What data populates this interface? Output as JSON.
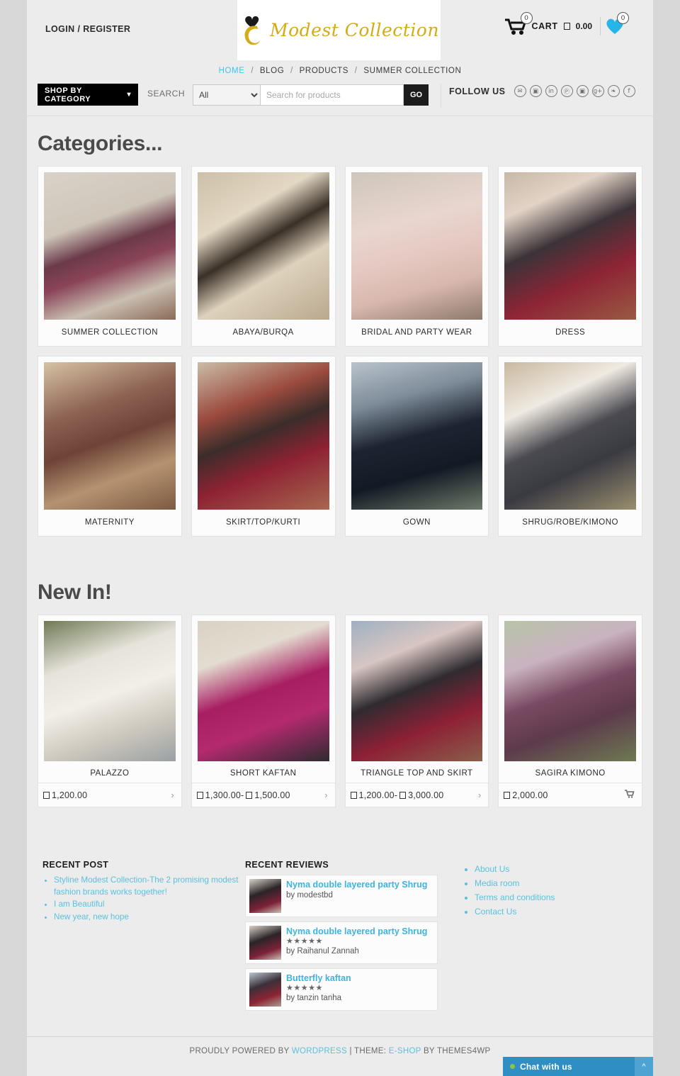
{
  "header": {
    "login_label": "LOGIN / REGISTER",
    "logo_text": "Modest Collection",
    "cart_label": "CART",
    "cart_amount": "0.00",
    "cart_count": "0",
    "wishlist_count": "0",
    "currency_glyph": "box-glyph"
  },
  "breadcrumb": {
    "items": [
      {
        "label": "HOME",
        "active": true
      },
      {
        "label": "BLOG",
        "active": false
      },
      {
        "label": "PRODUCTS",
        "active": false
      },
      {
        "label": "SUMMER COLLECTION",
        "active": false
      }
    ],
    "separator": "/"
  },
  "searchbar": {
    "shop_by_category": "SHOP BY CATEGORY",
    "search_label": "SEARCH",
    "category_selected": "All",
    "category_options": [
      "All"
    ],
    "placeholder": "Search for products",
    "search_value": "",
    "go_label": "GO",
    "follow_label": "FOLLOW US",
    "social": [
      {
        "name": "email-icon",
        "glyph": "✉"
      },
      {
        "name": "flickr-icon",
        "glyph": "▣"
      },
      {
        "name": "linkedin-icon",
        "glyph": "in"
      },
      {
        "name": "pinterest-icon",
        "glyph": "Ⓟ"
      },
      {
        "name": "instagram-icon",
        "glyph": "▣"
      },
      {
        "name": "googleplus-icon",
        "glyph": "g+"
      },
      {
        "name": "twitter-icon",
        "glyph": "❧"
      },
      {
        "name": "facebook-icon",
        "glyph": "f"
      }
    ]
  },
  "categories_section": {
    "title": "Categories...",
    "items": [
      {
        "label": "SUMMER COLLECTION",
        "img": "linear-gradient(160deg,#d9d2c8 0%,#cfc6ba 34%,#6b3a4a 50%,#8a4458 62%,#c9bfb2 80%,#8a6a58 100%)"
      },
      {
        "label": "ABAYA/BURQA",
        "img": "linear-gradient(150deg,#cdbfa8 0%,#e3d8c4 30%,#3a3028 48%,#ded2bd 66%,#b9a88e 100%)"
      },
      {
        "label": "BRIDAL AND PARTY WEAR",
        "img": "linear-gradient(165deg,#cfc6bb 0%,#e8d6cf 35%,#e5c9c2 55%,#d8b8ae 75%,#8d7a6c 100%)"
      },
      {
        "label": "DRESS",
        "img": "linear-gradient(155deg,#c7b9a6 0%,#e2d3c6 22%,#3b3338 45%,#8d2436 70%,#9a5a43 100%)"
      },
      {
        "label": "MATERNITY",
        "img": "linear-gradient(160deg,#d6c3a4 0%,#8d6253 32%,#6e4338 52%,#b59371 74%,#7b5a42 100%)"
      },
      {
        "label": "SKIRT/TOP/KURTI",
        "img": "linear-gradient(158deg,#cbbda8 0%,#9b4a3e 30%,#3b2d2a 48%,#8e2234 68%,#a6684f 100%)"
      },
      {
        "label": "GOWN",
        "img": "linear-gradient(165deg,#b9c3cc 0%,#7f8d9a 26%,#1d2330 50%,#141a24 72%,#6d7a6a 100%)"
      },
      {
        "label": "SHRUG/ROBE/KIMONO",
        "img": "linear-gradient(155deg,#c8b89f 0%,#efeae2 28%,#4a4a50 50%,#3a3a42 68%,#9a8f6f 100%)"
      }
    ]
  },
  "newin_section": {
    "title": "New In!",
    "items": [
      {
        "name": "PALAZZO",
        "price": "1,200.00",
        "price_suffix": "",
        "action": "chevron",
        "img": "linear-gradient(160deg,#6f7a55 0%,#e6e3db 30%,#f2efe8 52%,#cfcabf 74%,#9aa0a3 100%)"
      },
      {
        "name": "SHORT KAFTAN",
        "price": "1,300.00",
        "price_suffix": "1,500.00",
        "action": "chevron",
        "img": "linear-gradient(160deg,#d9d2c4 0%,#e3dcd0 26%,#a81e62 50%,#b42a6e 70%,#2e2b30 100%)"
      },
      {
        "name": "TRIANGLE TOP AND SKIRT",
        "price": "1,200.00",
        "price_suffix": "3,000.00",
        "action": "chevron",
        "img": "linear-gradient(158deg,#9fb0c2 0%,#d8c6c2 26%,#2f2b30 48%,#8d2036 72%,#8a5f4a 100%)"
      },
      {
        "name": "SAGIRA KIMONO",
        "price": "2,000.00",
        "price_suffix": "",
        "action": "cart",
        "img": "linear-gradient(160deg,#b7c4a8 0%,#c9b3c1 28%,#7a4a62 50%,#5d3a4c 70%,#6d7a52 100%)"
      }
    ]
  },
  "footer": {
    "recent_post": {
      "heading": "RECENT POST",
      "items": [
        "Styline Modest Collection-The 2 promising modest fashion brands works together!",
        "I am Beautiful",
        "New year, new hope"
      ]
    },
    "recent_reviews": {
      "heading": "RECENT REVIEWS",
      "items": [
        {
          "title": "Nyma double layered party Shrug",
          "stars": "",
          "by": "by modestbd",
          "img": "linear-gradient(160deg,#dad3ca 0%,#2a2428 40%,#7d2238 72%,#c9c0b4 100%)"
        },
        {
          "title": "Nyma double layered party Shrug",
          "stars": "★★★★★",
          "by": "by Raihanul Zannah",
          "img": "linear-gradient(160deg,#dad3ca 0%,#2a2428 40%,#7d2238 72%,#c9c0b4 100%)"
        },
        {
          "title": "Butterfly kaftan",
          "stars": "★★★★★",
          "by": "by tanzin tanha",
          "img": "linear-gradient(160deg,#b9c6d2 0%,#3a3038 38%,#8d2434 70%,#a9a092 100%)"
        }
      ]
    },
    "links": [
      "About Us",
      "Media room",
      "Terms and conditions",
      "Contact Us"
    ],
    "credit": {
      "prefix": "PROUDLY POWERED BY ",
      "wordpress": "WORDPRESS",
      "middle": " | THEME: ",
      "theme": "E-SHOP",
      "suffix": " BY THEMES4WP"
    }
  },
  "chat": {
    "label": "Chat with us",
    "caret": "^"
  }
}
